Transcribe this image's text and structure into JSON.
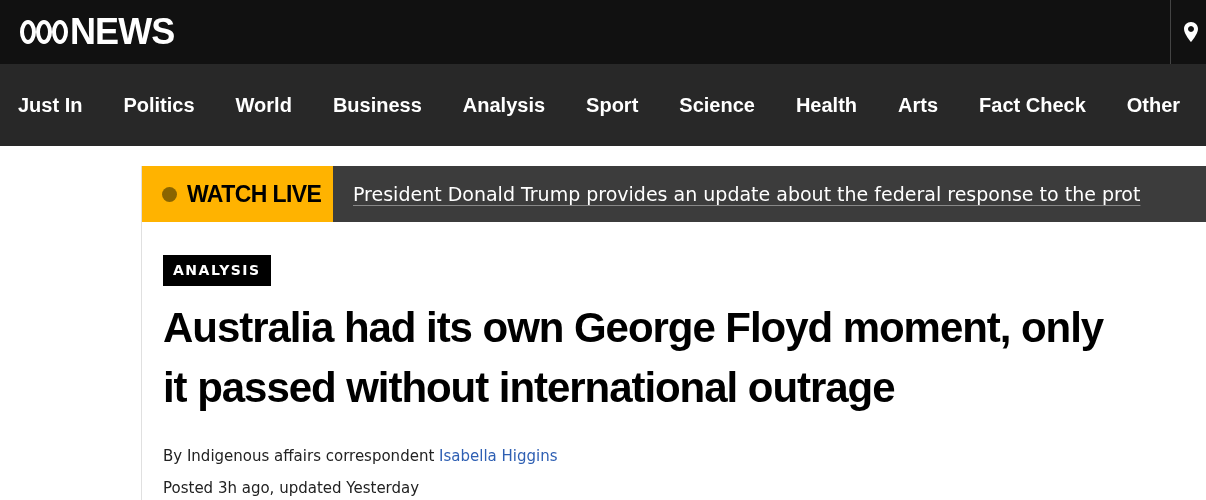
{
  "header": {
    "logo_text": "NEWS"
  },
  "nav": {
    "items": [
      {
        "label": "Just In"
      },
      {
        "label": "Politics"
      },
      {
        "label": "World"
      },
      {
        "label": "Business"
      },
      {
        "label": "Analysis"
      },
      {
        "label": "Sport"
      },
      {
        "label": "Science"
      },
      {
        "label": "Health"
      },
      {
        "label": "Arts"
      },
      {
        "label": "Fact Check"
      },
      {
        "label": "Other"
      }
    ]
  },
  "live_banner": {
    "label": "WATCH LIVE",
    "headline": "President Donald Trump provides an update about the federal response to the prot"
  },
  "article": {
    "tag": "ANALYSIS",
    "headline_lines": [
      "Australia had its own George Floyd moment, only",
      "it passed without international outrage"
    ],
    "byline_prefix": "By Indigenous affairs correspondent",
    "author": "Isabella Higgins",
    "posted": "Posted 3h ago, updated Yesterday"
  }
}
